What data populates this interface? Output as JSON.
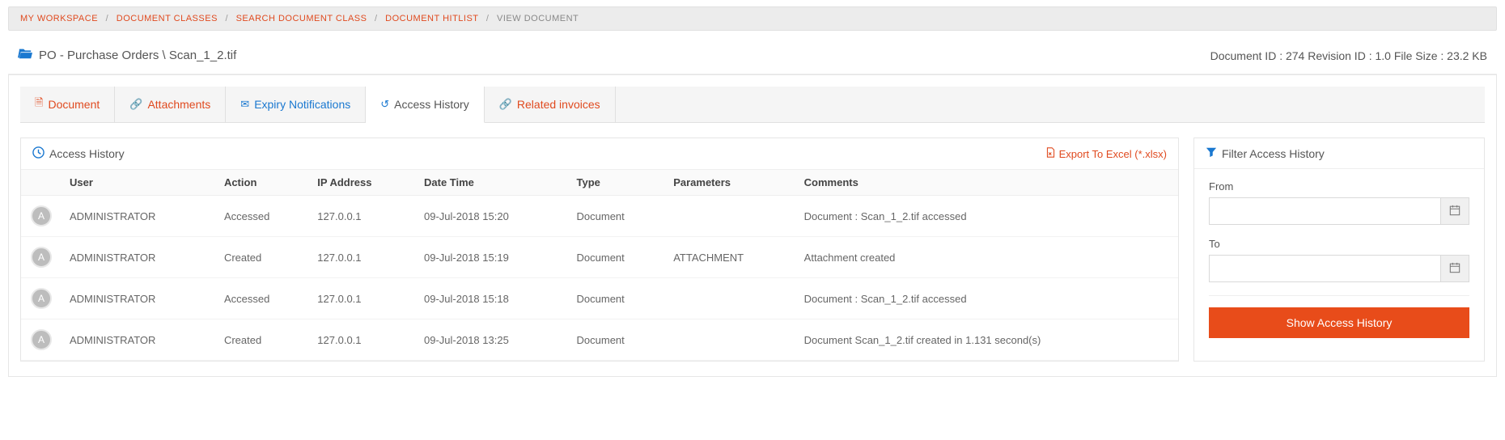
{
  "breadcrumb": {
    "items": [
      {
        "label": "MY WORKSPACE",
        "active": false
      },
      {
        "label": "DOCUMENT CLASSES",
        "active": false
      },
      {
        "label": "SEARCH DOCUMENT CLASS",
        "active": false
      },
      {
        "label": "DOCUMENT HITLIST",
        "active": false
      },
      {
        "label": "VIEW DOCUMENT",
        "active": true
      }
    ]
  },
  "title": {
    "path": "PO - Purchase Orders \\ Scan_1_2.tif",
    "meta": "Document ID : 274  Revision ID : 1.0  File Size : 23.2 KB"
  },
  "tabs": [
    {
      "label": "Document",
      "iconGlyph": "🗎",
      "style": "red"
    },
    {
      "label": "Attachments",
      "iconGlyph": "🔗",
      "style": "red"
    },
    {
      "label": "Expiry Notifications",
      "iconGlyph": "✉",
      "style": "blue"
    },
    {
      "label": "Access History",
      "iconGlyph": "↺",
      "style": "active"
    },
    {
      "label": "Related invoices",
      "iconGlyph": "🔗",
      "style": "red"
    }
  ],
  "historyPanel": {
    "title": "Access History",
    "exportLabel": "Export To Excel (*.xlsx)",
    "columns": [
      "",
      "User",
      "Action",
      "IP Address",
      "Date Time",
      "Type",
      "Parameters",
      "Comments"
    ],
    "rows": [
      {
        "avatar": "A",
        "user": "ADMINISTRATOR",
        "action": "Accessed",
        "ip": "127.0.0.1",
        "dt": "09-Jul-2018 15:20",
        "type": "Document",
        "params": "",
        "comments": "Document : Scan_1_2.tif accessed"
      },
      {
        "avatar": "A",
        "user": "ADMINISTRATOR",
        "action": "Created",
        "ip": "127.0.0.1",
        "dt": "09-Jul-2018 15:19",
        "type": "Document",
        "params": "ATTACHMENT",
        "comments": "Attachment created"
      },
      {
        "avatar": "A",
        "user": "ADMINISTRATOR",
        "action": "Accessed",
        "ip": "127.0.0.1",
        "dt": "09-Jul-2018 15:18",
        "type": "Document",
        "params": "",
        "comments": "Document : Scan_1_2.tif accessed"
      },
      {
        "avatar": "A",
        "user": "ADMINISTRATOR",
        "action": "Created",
        "ip": "127.0.0.1",
        "dt": "09-Jul-2018 13:25",
        "type": "Document",
        "params": "",
        "comments": "Document Scan_1_2.tif created in 1.131 second(s)"
      }
    ]
  },
  "filterPanel": {
    "title": "Filter Access History",
    "fromLabel": "From",
    "toLabel": "To",
    "buttonLabel": "Show Access History"
  }
}
